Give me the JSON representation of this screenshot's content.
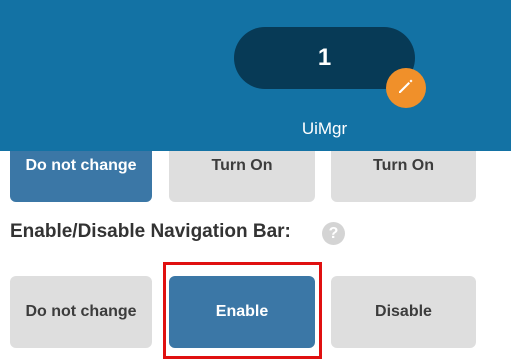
{
  "profile": {
    "number": "1",
    "name": "UiMgr",
    "edit_icon": "pencil-icon"
  },
  "previous_options": {
    "labels": [
      "Do not change",
      "Turn On",
      "Turn On"
    ]
  },
  "navigation_bar": {
    "label": "Enable/Disable Navigation Bar:",
    "help_symbol": "?",
    "options": [
      "Do not change",
      "Enable",
      "Disable"
    ],
    "selected": "Enable"
  },
  "colors": {
    "header": "#1372a4",
    "selected_option": "#3b77a6",
    "unselected_option": "#dedede",
    "edit_badge": "#f0902a",
    "highlight": "#e01010"
  }
}
